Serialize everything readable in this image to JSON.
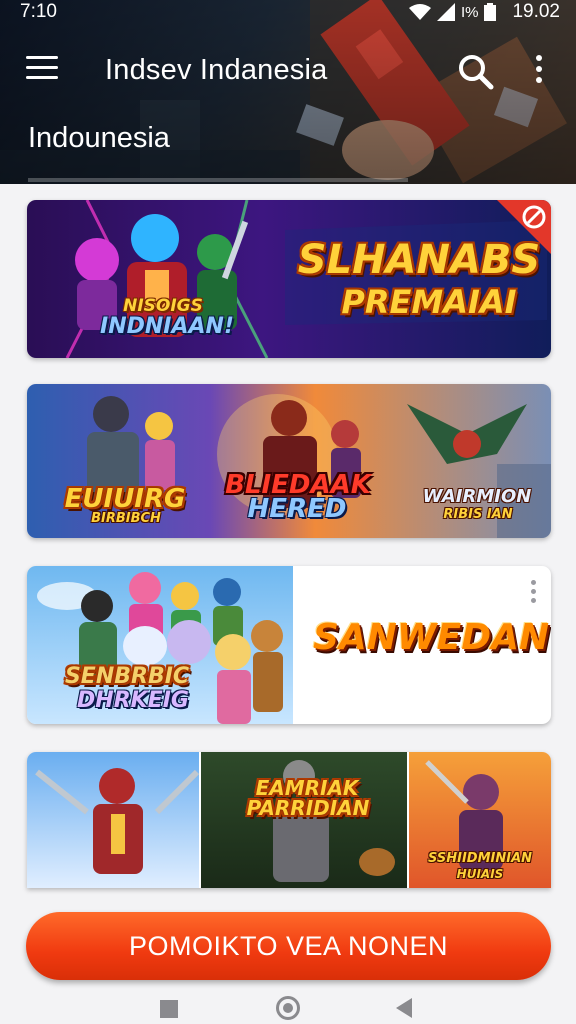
{
  "status_bar": {
    "time": "7:10",
    "battery_text": "I%",
    "clock_right": "19.02",
    "icons": [
      "wifi-icon",
      "signal-icon",
      "battery-icon"
    ]
  },
  "toolbar": {
    "title": "Indsev Indanesia",
    "menu_icon": "hamburger-menu-icon",
    "search_icon": "search-icon",
    "more_icon": "more-vertical-icon"
  },
  "section": {
    "label": "Indounesia"
  },
  "cards": [
    {
      "title_line1": "SLHANABS",
      "title_line2": "PREMAIAI",
      "subtitle_line1": "NISOIGS",
      "subtitle_line2": "INDNIAAN!",
      "badge_icon": "target-badge-icon"
    },
    {
      "left_title": "EUIUIRG",
      "left_sub": "BIRBIBCH",
      "center_title": "BLIEDAAK",
      "center_sub": "HERED",
      "right_title": "WAIRMION",
      "right_sub": "RIBIS IAN"
    },
    {
      "left_title": "SENBRBIC",
      "left_sub": "DHRKEIG",
      "right_title": "SANWEDAN",
      "more_icon": "more-vertical-icon"
    },
    {
      "center_title_line1": "EAMRIAK",
      "center_title_line2": "PARRIDIAN",
      "right_title_line1": "SSHIIDMINIAN",
      "right_title_line2": "HUIAIS"
    }
  ],
  "cta": {
    "label": "POMOIKTO VEA NONEN"
  },
  "nav_bar": {
    "icons": [
      "back-square-icon",
      "home-circle-icon",
      "recents-triangle-icon"
    ]
  },
  "colors": {
    "accent": "#f03a10",
    "header_dark": "#0d1626",
    "background": "#f3f3f5"
  }
}
